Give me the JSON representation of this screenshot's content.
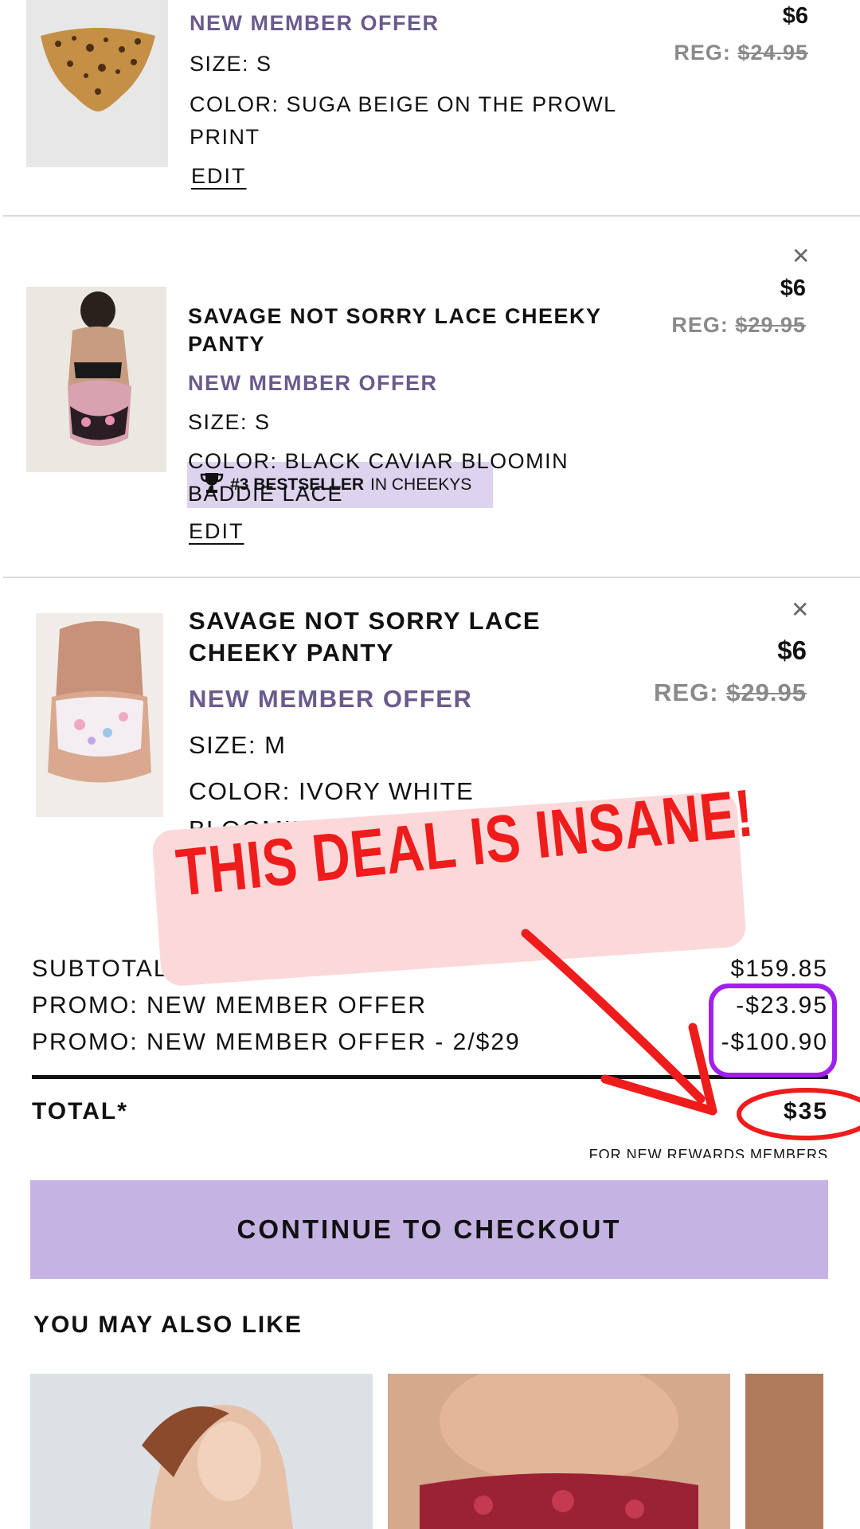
{
  "items": [
    {
      "name": "",
      "badge": null,
      "offer": "NEW MEMBER OFFER",
      "size": "SIZE: S",
      "color_line1": "COLOR: SUGA BEIGE ON THE PROWL",
      "color_line2": "PRINT",
      "edit": "EDIT",
      "price": "$6",
      "reg_label": "REG:",
      "reg_price": "$24.95"
    },
    {
      "badge": {
        "rank": "#3 BESTSELLER",
        "rest": "IN CHEEKYS",
        "icon": "trophy-icon"
      },
      "name_line1": "SAVAGE NOT SORRY LACE CHEEKY",
      "name_line2": "PANTY",
      "offer": "NEW MEMBER OFFER",
      "size": "SIZE: S",
      "color_line1": "COLOR: BLACK CAVIAR BLOOMIN",
      "color_line2": "BADDIE LACE",
      "edit": "EDIT",
      "price": "$6",
      "reg_label": "REG:",
      "reg_price": "$29.95"
    },
    {
      "name_line1": "SAVAGE NOT SORRY LACE",
      "name_line2": "CHEEKY PANTY",
      "offer": "NEW MEMBER OFFER",
      "size": "SIZE: M",
      "color_line1": "COLOR: IVORY WHITE",
      "color_line2": "BLOOMIN BADDIE LACE",
      "price": "$6",
      "reg_label": "REG:",
      "reg_price": "$29.95"
    }
  ],
  "annotation": {
    "banner_text": "THIS DEAL IS INSANE!"
  },
  "summary": {
    "subtotal_label": "SUBTOTAL",
    "subtotal_value": "$159.85",
    "promo1_label": "PROMO: NEW MEMBER OFFER",
    "promo1_value": "-$23.95",
    "promo2_label": "PROMO: NEW MEMBER OFFER - 2/$29",
    "promo2_value": "-$100.90",
    "total_label": "TOTAL*",
    "total_value": "$35",
    "note": "FOR NEW REWARDS MEMBERS"
  },
  "checkout_label": "CONTINUE TO CHECKOUT",
  "recommendations_title": "YOU MAY ALSO LIKE",
  "colors": {
    "offer": "#6b5b8c",
    "checkout_bg": "#c5b3e3",
    "badge_bg": "#ddd3ef",
    "annotation_red": "#ef1c1c",
    "annotation_purple": "#a020f0"
  }
}
